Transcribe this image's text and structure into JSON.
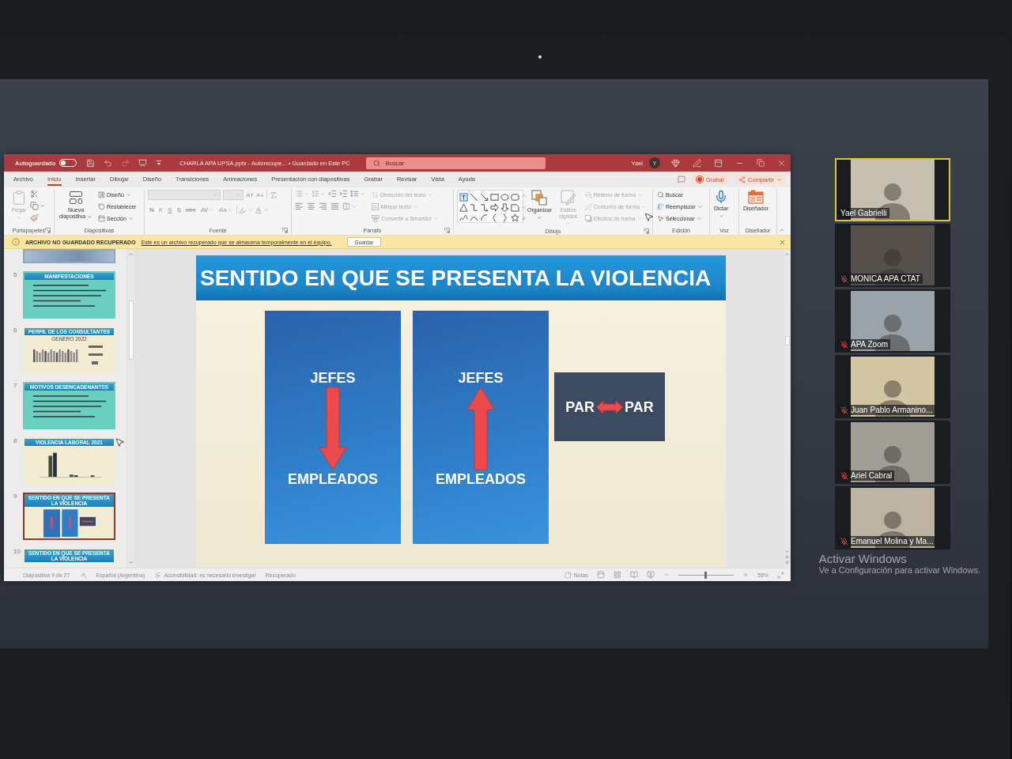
{
  "powerpoint": {
    "title_bar": {
      "autosave_label": "Autoguardado",
      "autosave_on": false,
      "title": "CHARLA APA UPSA.pptx - Autorecupe... • Guardado en Este PC",
      "search": {
        "placeholder": "Buscar"
      },
      "user_name": "Yael",
      "avatar_initial": "Y"
    },
    "tabs": [
      {
        "label": "Archivo",
        "selected": false
      },
      {
        "label": "Inicio",
        "selected": true
      },
      {
        "label": "Insertar",
        "selected": false
      },
      {
        "label": "Dibujar",
        "selected": false
      },
      {
        "label": "Diseño",
        "selected": false
      },
      {
        "label": "Transiciones",
        "selected": false
      },
      {
        "label": "Animaciones",
        "selected": false
      },
      {
        "label": "Presentación con diapositivas",
        "selected": false
      },
      {
        "label": "Grabar",
        "selected": false
      },
      {
        "label": "Revisar",
        "selected": false
      },
      {
        "label": "Vista",
        "selected": false
      },
      {
        "label": "Ayuda",
        "selected": false
      }
    ],
    "tab_actions": {
      "record": "Grabar",
      "share": "Compartir"
    },
    "ribbon": {
      "clipboard": {
        "label": "Portapapeles",
        "paste": {
          "label": "Pegar",
          "disabled": true
        }
      },
      "slides": {
        "label": "Diapositivas",
        "new_slide": {
          "label": "Nueva diapositiva",
          "disabled": false
        },
        "layout": {
          "label": "Diseño",
          "disabled": false
        },
        "reset": {
          "label": "Restablecer",
          "disabled": false
        },
        "section": {
          "label": "Sección",
          "disabled": false
        }
      },
      "font": {
        "label": "Fuente",
        "buttons": [
          {
            "kind": "bold",
            "label": "N",
            "disabled": true
          },
          {
            "kind": "italic",
            "label": "K",
            "disabled": true
          },
          {
            "kind": "underline",
            "label": "S",
            "disabled": true
          },
          {
            "kind": "shadow",
            "label": "S",
            "disabled": true
          },
          {
            "kind": "strikethrough",
            "label": "abc",
            "disabled": true
          },
          {
            "kind": "spacing",
            "label": "AV",
            "disabled": true
          },
          {
            "kind": "case",
            "label": "Aa",
            "disabled": true
          }
        ]
      },
      "paragraph": {
        "label": "Párrafo",
        "text_direction": {
          "label": "Dirección del texto",
          "disabled": true
        },
        "align_text": {
          "label": "Alinear texto",
          "disabled": true
        },
        "smartart": {
          "label": "Convertir a SmartArt",
          "disabled": true
        }
      },
      "drawing": {
        "label": "Dibujo",
        "arrange": {
          "label": "Organizar",
          "disabled": false
        },
        "quick_styles": {
          "label": "Estilos rápidos",
          "disabled": true
        },
        "fill": {
          "label": "Relleno de forma",
          "disabled": true
        },
        "outline": {
          "label": "Contorno de forma",
          "disabled": true
        },
        "effects": {
          "label": "Efectos de forma",
          "disabled": true
        }
      },
      "editing": {
        "label": "Edición",
        "find": {
          "label": "Buscar",
          "disabled": false
        },
        "replace": {
          "label": "Reemplazar",
          "disabled": false
        },
        "select": {
          "label": "Seleccionar",
          "disabled": false
        }
      },
      "voice": {
        "label": "Voz",
        "dictate": {
          "label": "Dictar",
          "disabled": false
        }
      },
      "designer": {
        "label": "Diseñador",
        "designer": {
          "label": "Diseñador",
          "disabled": false
        }
      }
    },
    "recovery_bar": {
      "title": "ARCHIVO NO GUARDADO RECUPERADO",
      "message": "Este es un archivo recuperado que se almacena temporalmente en el equipo.",
      "button": "Guardar"
    },
    "slide_thumbnails": [
      {
        "kind": "image",
        "selected": false
      },
      {
        "number": "5",
        "kind": "bullets",
        "title": "MANIFESTACIONES",
        "selected": false
      },
      {
        "number": "6",
        "kind": "pictogram",
        "title": "PERFIL DE LOS CONSULTANTES",
        "subtitle": "GENERO 2022",
        "selected": false
      },
      {
        "number": "7",
        "kind": "bullets",
        "title": "MOTIVOS DESENCADENANTES",
        "selected": false
      },
      {
        "number": "8",
        "kind": "bar_chart",
        "title": "VIOLENCIA LABORAL 2021",
        "selected": false
      },
      {
        "number": "9",
        "kind": "slide_preview",
        "title": "SENTIDO EN QUE SE PRESENTA LA VIOLENCIA",
        "selected": true
      },
      {
        "number": "10",
        "kind": "title_only",
        "title": "SENTIDO EN QUE SE PRESENTA LA VIOLENCIA",
        "selected": false
      }
    ],
    "slide": {
      "title": "SENTIDO EN QUE SE PRESENTA LA VIOLENCIA",
      "panels": [
        {
          "kind": "down_arrow",
          "top_label": "JEFES",
          "bottom_label": "EMPLEADOS"
        },
        {
          "kind": "up_arrow",
          "top_label": "JEFES",
          "bottom_label": "EMPLEADOS"
        }
      ],
      "peer_box": {
        "left_label": "PAR",
        "right_label": "PAR"
      }
    },
    "status_bar": {
      "slide_count": "Diapositiva 9 de 27",
      "language": "Español (Argentina)",
      "accessibility": "Accesibilidad: es necesario investigar",
      "save_state": "Recuperado",
      "notes": "Notas",
      "zoom": {
        "level": 0.5,
        "reading": "55%"
      }
    }
  },
  "zoom_participants": [
    {
      "name": "Yael Gabrielli",
      "muted": false,
      "speaking": true
    },
    {
      "name": "MONICA APA CTAT",
      "muted": true,
      "speaking": false
    },
    {
      "name": "APA Zoom",
      "muted": true,
      "speaking": false
    },
    {
      "name": "Juan Pablo Armanino...",
      "muted": true,
      "speaking": false
    },
    {
      "name": "Ariel Cabral",
      "muted": true,
      "speaking": false
    },
    {
      "name": "Emanuel Molina y Ma...",
      "muted": true,
      "speaking": false
    }
  ],
  "windows_activation": {
    "title": "Activar Windows",
    "message": "Ve a Configuración para activar Windows."
  }
}
